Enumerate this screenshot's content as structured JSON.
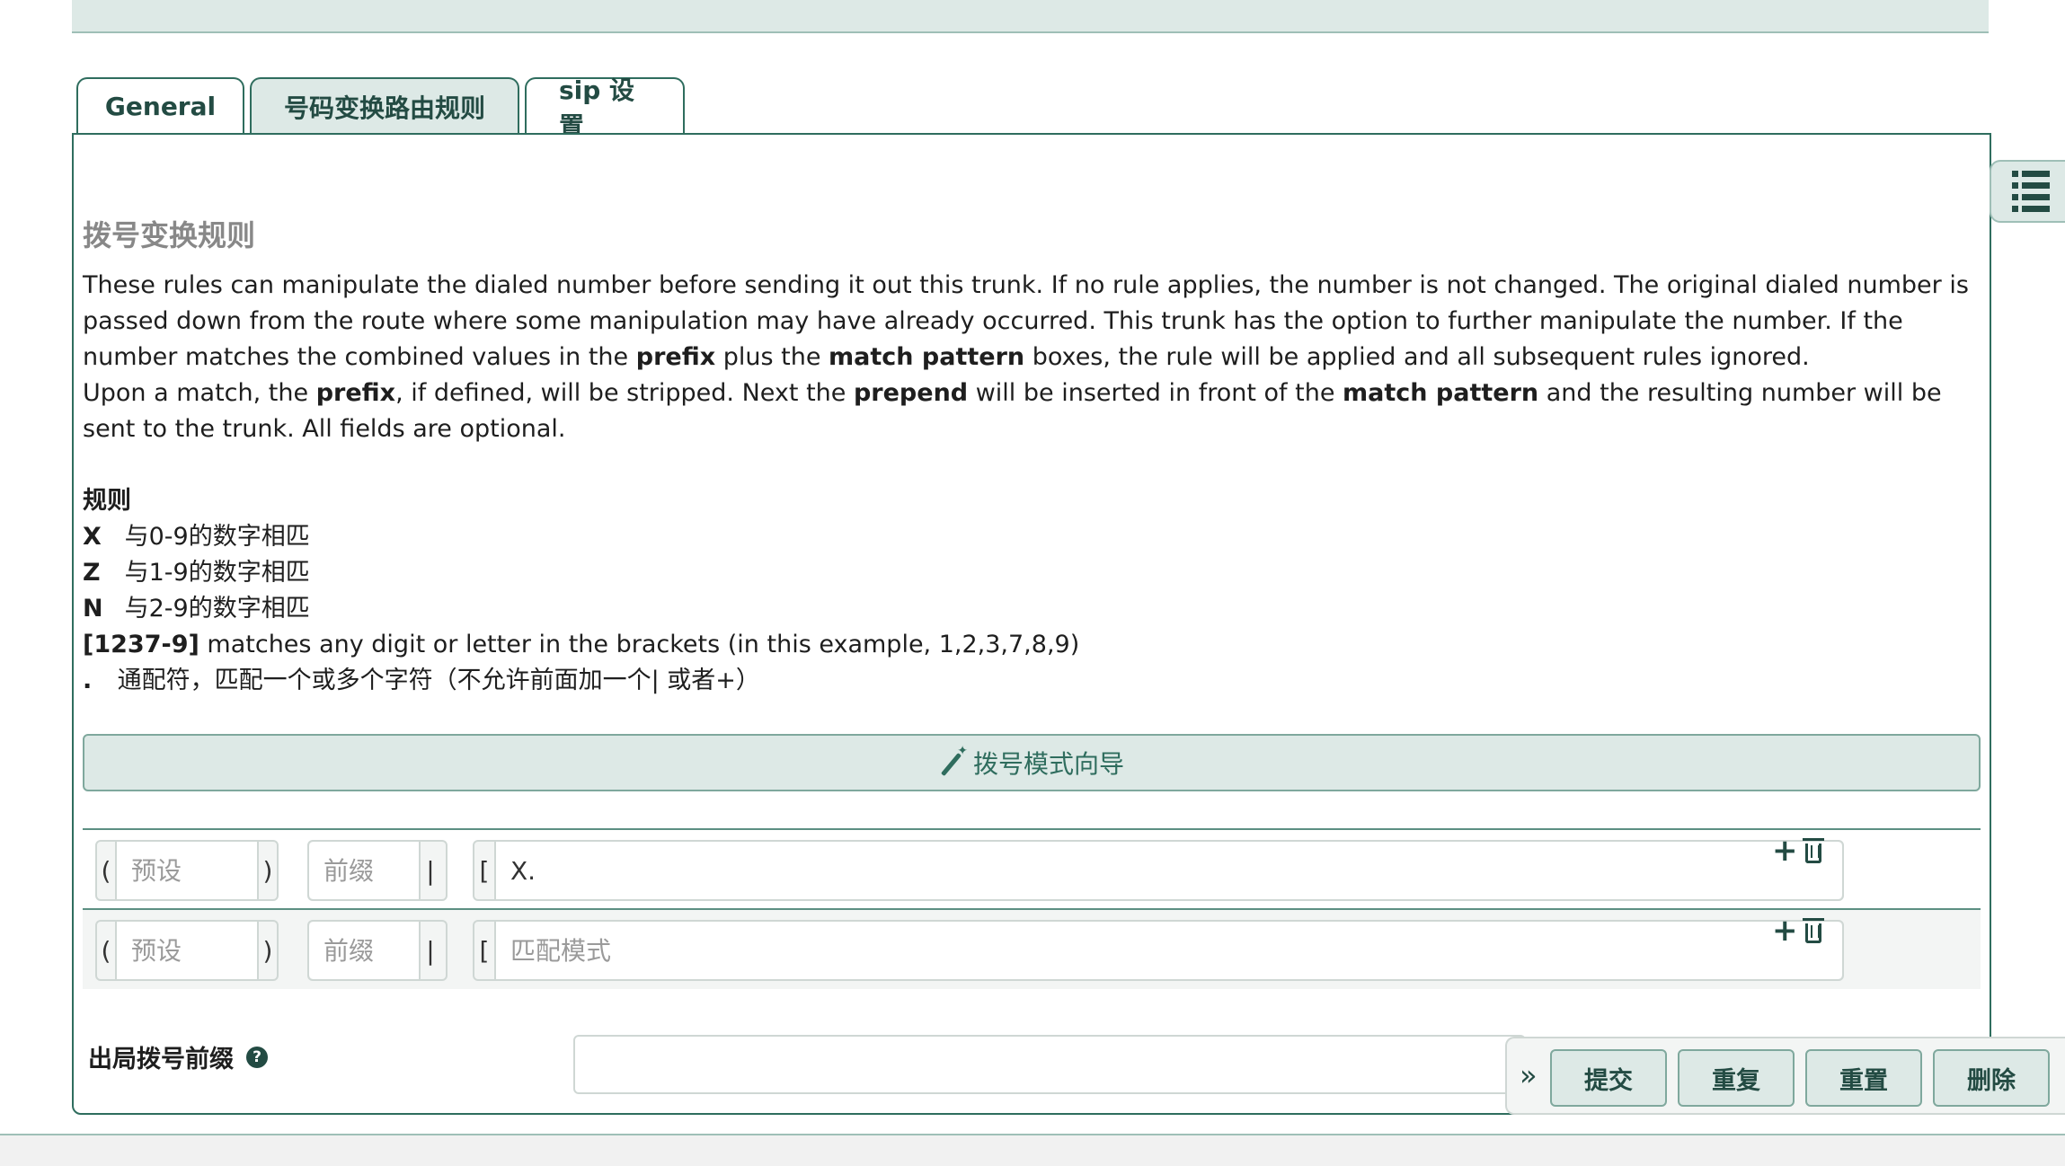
{
  "tabs": [
    {
      "label": "General",
      "active": false
    },
    {
      "label": "号码变换路由规则",
      "active": true
    },
    {
      "label": "sip 设置",
      "active": false
    }
  ],
  "section": {
    "title": "拨号变换规则",
    "desc_p1_a": "These rules can manipulate the dialed number before sending it out this trunk. If no rule applies, the number is not changed. The original dialed number is passed down from the route where some manipulation may have already occurred. This trunk has the option to further manipulate the number. If the number matches the combined values in the ",
    "desc_p1_prefix": "prefix",
    "desc_p1_b": " plus the ",
    "desc_p1_match": "match pattern",
    "desc_p1_c": " boxes, the rule will be applied and all subsequent rules ignored.",
    "desc_p2_a": "Upon a match, the ",
    "desc_p2_prefix": "prefix",
    "desc_p2_b": ", if defined, will be stripped. Next the ",
    "desc_p2_prepend": "prepend",
    "desc_p2_c": " will be inserted in front of the ",
    "desc_p2_match": "match pattern",
    "desc_p2_d": " and the resulting number will be sent to the trunk. All fields are optional."
  },
  "rules": {
    "title": "规则",
    "items": [
      {
        "key": "X",
        "text": "与0-9的数字相匹"
      },
      {
        "key": "Z",
        "text": "与1-9的数字相匹"
      },
      {
        "key": "N",
        "text": "与2-9的数字相匹"
      },
      {
        "key": "[1237-9]",
        "text": "matches any digit or letter in the brackets (in this example, 1,2,3,7,8,9)"
      },
      {
        "key": ".",
        "text": "通配符，匹配一个或多个字符（不允许前面加一个| 或者+）"
      }
    ]
  },
  "wizard": {
    "label": "拨号模式向导",
    "icon": "magic-wand-icon"
  },
  "patterns": {
    "open_paren": "(",
    "close_paren": ")",
    "pipe": "|",
    "bracket": "[",
    "rows": [
      {
        "prepend_placeholder": "预设",
        "prefix_placeholder": "前缀",
        "match_value": "X.",
        "match_placeholder": "匹配模式"
      },
      {
        "prepend_placeholder": "预设",
        "prefix_placeholder": "前缀",
        "match_value": "",
        "match_placeholder": "匹配模式"
      }
    ]
  },
  "dial_prefix": {
    "label": "出局拨号前缀",
    "help": "?",
    "value": ""
  },
  "actions": {
    "collapse": "»",
    "submit": "提交",
    "repeat": "重复",
    "reset": "重置",
    "delete": "删除"
  }
}
